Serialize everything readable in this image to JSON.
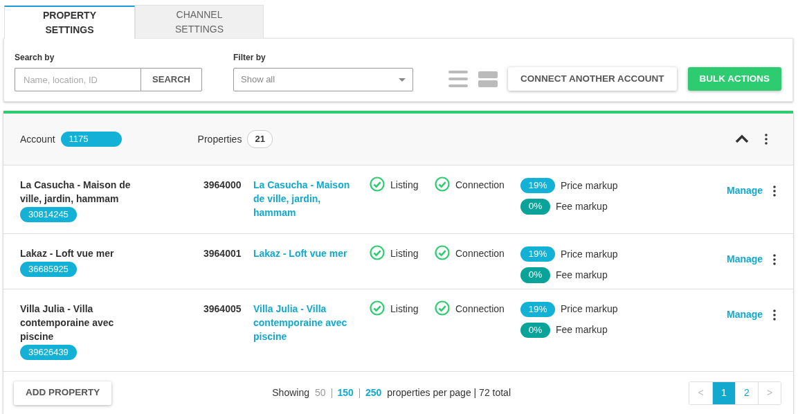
{
  "tabs": [
    {
      "label": "PROPERTY SETTINGS",
      "selected": true
    },
    {
      "label": "CHANNEL SETTINGS",
      "selected": false
    }
  ],
  "toolbar": {
    "search_label": "Search by",
    "search_placeholder": "Name, location, ID",
    "search_button": "SEARCH",
    "filter_label": "Filter by",
    "filter_value": "Show all",
    "connect_button": "CONNECT ANOTHER ACCOUNT",
    "bulk_button": "BULK ACTIONS"
  },
  "account": {
    "label": "Account",
    "id": "1175",
    "properties_label": "Properties",
    "properties_count": "21",
    "expanded": true
  },
  "rows": [
    {
      "name": "La Casucha - Maison de ville, jardin, hammam",
      "badge": "30814245",
      "id": "3964000",
      "listing_name": "La Casucha - Maison de ville, jardin, hammam",
      "checks": [
        {
          "label": "Listing",
          "ok": true
        },
        {
          "label": "Connection",
          "ok": true
        }
      ],
      "markups": [
        {
          "value": "19%",
          "label": "Price markup",
          "kind": "price"
        },
        {
          "value": "0%",
          "label": "Fee markup",
          "kind": "fee"
        }
      ],
      "manage": "Manage"
    },
    {
      "name": "Lakaz - Loft vue mer",
      "badge": "36685925",
      "id": "3964001",
      "listing_name": "Lakaz - Loft vue mer",
      "checks": [
        {
          "label": "Listing",
          "ok": true
        },
        {
          "label": "Connection",
          "ok": true
        }
      ],
      "markups": [
        {
          "value": "19%",
          "label": "Price markup",
          "kind": "price"
        },
        {
          "value": "0%",
          "label": "Fee markup",
          "kind": "fee"
        }
      ],
      "manage": "Manage"
    },
    {
      "name": "Villa Julia - Villa contemporaine avec piscine",
      "badge": "39626439",
      "id": "3964005",
      "listing_name": "Villa Julia - Villa contemporaine avec piscine",
      "checks": [
        {
          "label": "Listing",
          "ok": true
        },
        {
          "label": "Connection",
          "ok": true
        }
      ],
      "markups": [
        {
          "value": "19%",
          "label": "Price markup",
          "kind": "price"
        },
        {
          "value": "0%",
          "label": "Fee markup",
          "kind": "fee"
        }
      ],
      "manage": "Manage"
    }
  ],
  "footer": {
    "add_button": "ADD PROPERTY",
    "showing": "Showing",
    "page_sizes": [
      {
        "label": "50",
        "selected": true
      },
      {
        "label": "150",
        "selected": false
      },
      {
        "label": "250",
        "selected": false
      }
    ],
    "per_page": "properties per page | 72 total",
    "pagination": [
      {
        "label": "<",
        "kind": "prev",
        "selected": false
      },
      {
        "label": "1",
        "kind": "page",
        "selected": true
      },
      {
        "label": "2",
        "kind": "page",
        "selected": false
      },
      {
        "label": ">",
        "kind": "next",
        "selected": false
      }
    ]
  }
}
